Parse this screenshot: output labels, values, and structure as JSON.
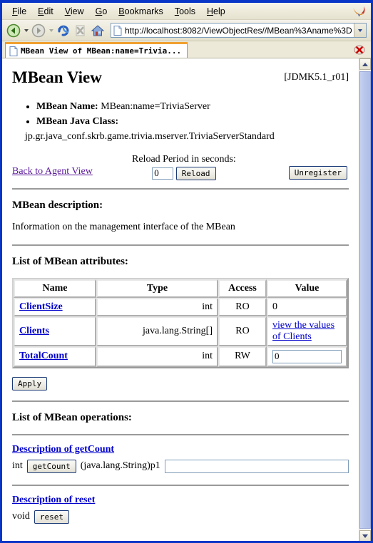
{
  "browser": {
    "menus": [
      {
        "pre": "",
        "key": "F",
        "post": "ile"
      },
      {
        "pre": "",
        "key": "E",
        "post": "dit"
      },
      {
        "pre": "",
        "key": "V",
        "post": "iew"
      },
      {
        "pre": "",
        "key": "G",
        "post": "o"
      },
      {
        "pre": "",
        "key": "B",
        "post": "ookmarks"
      },
      {
        "pre": "",
        "key": "T",
        "post": "ools"
      },
      {
        "pre": "",
        "key": "H",
        "post": "elp"
      }
    ],
    "url": "http://localhost:8082/ViewObjectRes//MBean%3Aname%3D",
    "tab_title": "MBean View of MBean:name=Trivia...",
    "nav": {
      "back": "Back",
      "forward": "Forward",
      "reload": "Reload",
      "stop": "Stop",
      "home": "Home"
    }
  },
  "page": {
    "title": "MBean View",
    "version": "[JDMK5.1_r01]",
    "info": {
      "name_label": "MBean Name:",
      "name_value": "MBean:name=TriviaServer",
      "class_label": "MBean Java Class:",
      "class_value": "jp.gr.java_conf.skrb.game.trivia.mserver.TriviaServerStandard"
    },
    "controls": {
      "back_link": "Back to Agent View",
      "reload_label": "Reload Period in seconds:",
      "reload_value": "0",
      "reload_button": "Reload",
      "unregister_button": "Unregister"
    },
    "description": {
      "heading": "MBean description:",
      "text": "Information on the management interface of the MBean"
    },
    "attributes": {
      "heading": "List of MBean attributes:",
      "columns": [
        "Name",
        "Type",
        "Access",
        "Value"
      ],
      "rows": [
        {
          "name": "ClientSize",
          "type": "int",
          "access": "RO",
          "value": "0",
          "value_kind": "text"
        },
        {
          "name": "Clients",
          "type": "java.lang.String[]",
          "access": "RO",
          "value": "view the values of Clients",
          "value_kind": "link"
        },
        {
          "name": "TotalCount",
          "type": "int",
          "access": "RW",
          "value": "0",
          "value_kind": "input"
        }
      ],
      "apply_button": "Apply"
    },
    "operations": {
      "heading": "List of MBean operations:",
      "items": [
        {
          "description_link": "Description of getCount",
          "return_type": "int",
          "button": "getCount",
          "param_label": "(java.lang.String)p1",
          "param_value": "",
          "has_param": true
        },
        {
          "description_link": "Description of reset",
          "return_type": "void",
          "button": "reset",
          "param_label": "",
          "param_value": "",
          "has_param": false
        }
      ]
    }
  }
}
